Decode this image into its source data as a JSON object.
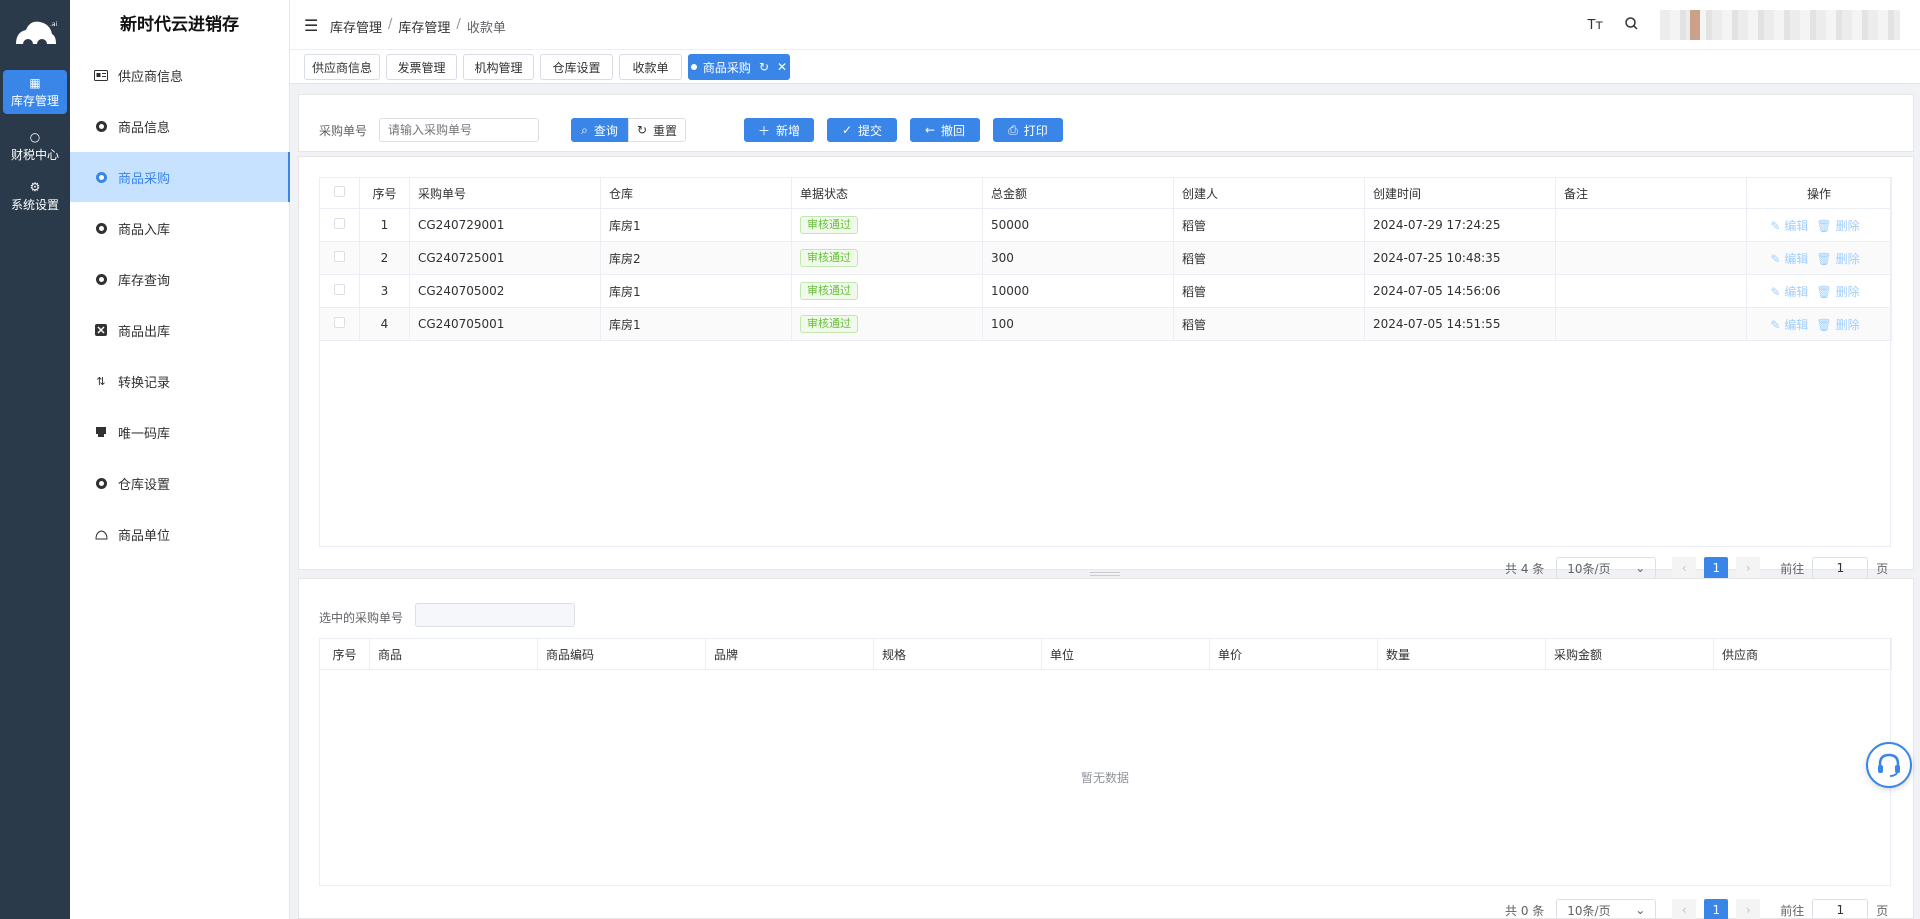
{
  "rail": {
    "items": [
      {
        "label": "库存管理",
        "icon": "grid-icon"
      },
      {
        "label": "财税中心",
        "icon": "apple-icon"
      },
      {
        "label": "系统设置",
        "icon": "gear-icon"
      }
    ]
  },
  "sidebar": {
    "title": "新时代云进销存",
    "items": [
      {
        "label": "供应商信息",
        "icon": "id-card-icon"
      },
      {
        "label": "商品信息",
        "icon": "circle-icon"
      },
      {
        "label": "商品采购",
        "icon": "circle-icon"
      },
      {
        "label": "商品入库",
        "icon": "circle-icon"
      },
      {
        "label": "库存查询",
        "icon": "circle-icon"
      },
      {
        "label": "商品出库",
        "icon": "export-icon"
      },
      {
        "label": "转换记录",
        "icon": "swap-icon"
      },
      {
        "label": "唯一码库",
        "icon": "printer-icon"
      },
      {
        "label": "仓库设置",
        "icon": "circle-icon"
      },
      {
        "label": "商品单位",
        "icon": "bell-icon"
      }
    ]
  },
  "header": {
    "breadcrumb": [
      "库存管理",
      "库存管理",
      "收款单"
    ]
  },
  "tags": [
    "供应商信息",
    "发票管理",
    "机构管理",
    "仓库设置",
    "收款单",
    "商品采购"
  ],
  "search": {
    "label": "采购单号",
    "placeholder": "请输入采购单号",
    "query": "查询",
    "reset": "重置",
    "add": "新增",
    "submit": "提交",
    "revoke": "撤回",
    "print": "打印"
  },
  "table": {
    "headers": [
      "序号",
      "采购单号",
      "仓库",
      "单据状态",
      "总金额",
      "创建人",
      "创建时间",
      "备注",
      "操作"
    ],
    "rows": [
      {
        "no": "1",
        "code": "CG240729001",
        "warehouse": "库房1",
        "status": "审核通过",
        "amount": "50000",
        "creator": "稻管",
        "time": "2024-07-29 17:24:25",
        "remark": ""
      },
      {
        "no": "2",
        "code": "CG240725001",
        "warehouse": "库房2",
        "status": "审核通过",
        "amount": "300",
        "creator": "稻管",
        "time": "2024-07-25 10:48:35",
        "remark": ""
      },
      {
        "no": "3",
        "code": "CG240705002",
        "warehouse": "库房1",
        "status": "审核通过",
        "amount": "10000",
        "creator": "稻管",
        "time": "2024-07-05 14:56:06",
        "remark": ""
      },
      {
        "no": "4",
        "code": "CG240705001",
        "warehouse": "库房1",
        "status": "审核通过",
        "amount": "100",
        "creator": "稻管",
        "time": "2024-07-05 14:51:55",
        "remark": ""
      }
    ],
    "edit": "编辑",
    "delete": "删除",
    "pager": {
      "total": "共 4 条",
      "size": "10条/页",
      "page": "1",
      "goto": "前往",
      "goto_val": "1",
      "unit": "页"
    }
  },
  "detail": {
    "label": "选中的采购单号",
    "headers": [
      "序号",
      "商品",
      "商品编码",
      "品牌",
      "规格",
      "单位",
      "单价",
      "数量",
      "采购金额",
      "供应商"
    ],
    "empty": "暂无数据",
    "pager": {
      "total": "共 0 条",
      "size": "10条/页",
      "page": "1",
      "goto": "前往",
      "goto_val": "1",
      "unit": "页"
    }
  }
}
